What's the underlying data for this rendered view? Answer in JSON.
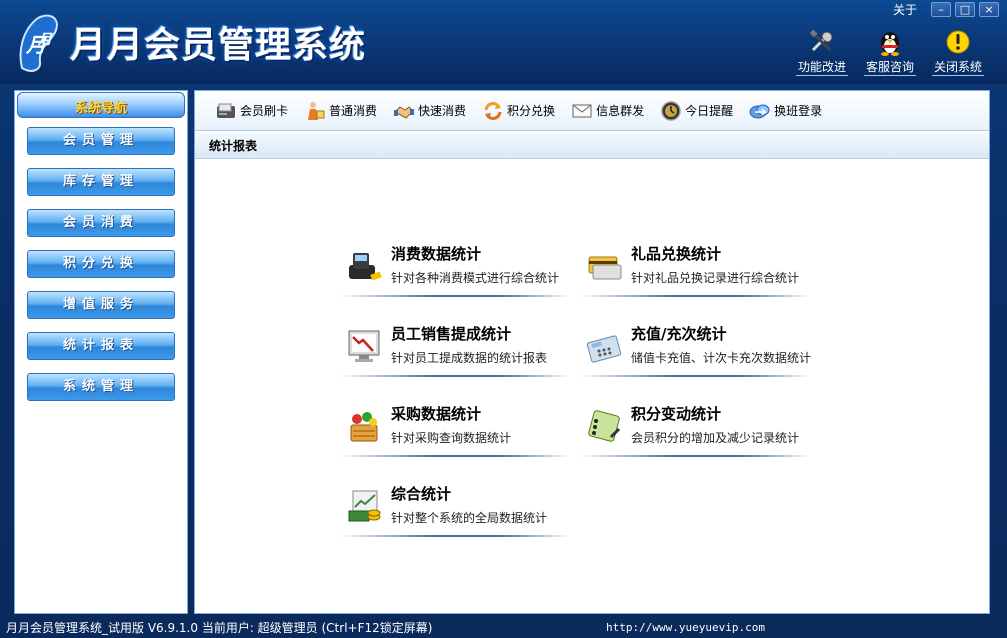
{
  "window": {
    "title": "月月会员管理系统",
    "about_label": "关于",
    "minimize": "–",
    "maximize": "□",
    "close": "×"
  },
  "top_tools": [
    {
      "label": "功能改进",
      "icon": "tools-icon"
    },
    {
      "label": "客服咨询",
      "icon": "qq-penguin-icon"
    },
    {
      "label": "关闭系统",
      "icon": "warning-icon"
    }
  ],
  "sidebar": {
    "header": "系统导航",
    "items": [
      "会员管理",
      "库存管理",
      "会员消费",
      "积分兑换",
      "增值服务",
      "统计报表",
      "系统管理"
    ]
  },
  "toolbar": {
    "items": [
      {
        "label": "会员刷卡",
        "icon": "card-reader-icon"
      },
      {
        "label": "普通消费",
        "icon": "shopper-icon"
      },
      {
        "label": "快速消费",
        "icon": "handshake-icon"
      },
      {
        "label": "积分兑换",
        "icon": "exchange-icon"
      },
      {
        "label": "信息群发",
        "icon": "envelope-icon"
      },
      {
        "label": "今日提醒",
        "icon": "clock-icon"
      },
      {
        "label": "换班登录",
        "icon": "relogin-icon"
      }
    ]
  },
  "breadcrumb": "统计报表",
  "stats": [
    {
      "title": "消费数据统计",
      "desc": "针对各种消费模式进行综合统计",
      "icon": "pos-terminal-icon"
    },
    {
      "title": "礼品兑换统计",
      "desc": "针对礼品兑换记录进行综合统计",
      "icon": "cards-icon"
    },
    {
      "title": "员工销售提成统计",
      "desc": "针对员工提成数据的统计报表",
      "icon": "monitor-chart-icon"
    },
    {
      "title": "充值/充次统计",
      "desc": "储值卡充值、计次卡充次数据统计",
      "icon": "calculator-icon"
    },
    {
      "title": "采购数据统计",
      "desc": "针对采购查询数据统计",
      "icon": "shopping-basket-icon"
    },
    {
      "title": "积分变动统计",
      "desc": "会员积分的增加及减少记录统计",
      "icon": "notebook-icon"
    },
    {
      "title": "综合统计",
      "desc": "针对整个系统的全局数据统计",
      "icon": "money-chart-icon"
    }
  ],
  "status": {
    "left": "月月会员管理系统_试用版 V6.9.1.0 当前用户: 超级管理员 (Ctrl+F12锁定屏幕)",
    "url": "http://www.yueyuevip.com"
  }
}
